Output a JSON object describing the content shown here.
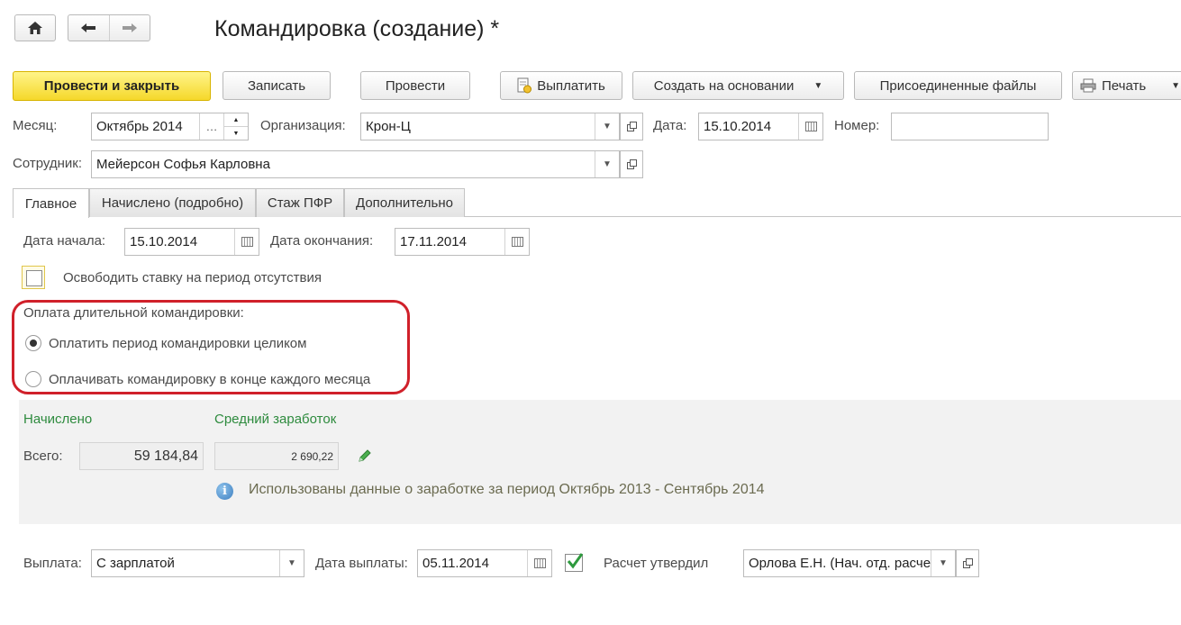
{
  "window": {
    "title": "Командировка (создание) *"
  },
  "toolbar": {
    "post_close": "Провести и закрыть",
    "save": "Записать",
    "post": "Провести",
    "pay": "Выплатить",
    "create_based": "Создать на основании",
    "attached_files": "Присоединенные файлы",
    "print": "Печать"
  },
  "header": {
    "month_label": "Месяц:",
    "month_value": "Октябрь 2014",
    "org_label": "Организация:",
    "org_value": "Крон-Ц",
    "date_label": "Дата:",
    "date_value": "15.10.2014",
    "number_label": "Номер:",
    "number_value": "",
    "employee_label": "Сотрудник:",
    "employee_value": "Мейерсон Софья Карловна"
  },
  "tabs": [
    {
      "label": "Главное",
      "active": true
    },
    {
      "label": "Начислено (подробно)",
      "active": false
    },
    {
      "label": "Стаж ПФР",
      "active": false
    },
    {
      "label": "Дополнительно",
      "active": false
    }
  ],
  "main": {
    "start_label": "Дата начала:",
    "start_value": "15.10.2014",
    "end_label": "Дата окончания:",
    "end_value": "17.11.2014",
    "free_rate_label": "Освободить ставку на период отсутствия",
    "free_rate_checked": false,
    "payment_group_label": "Оплата длительной командировки:",
    "payment_options": [
      {
        "label": "Оплатить период командировки целиком",
        "selected": true
      },
      {
        "label": "Оплачивать командировку в конце каждого месяца",
        "selected": false
      }
    ]
  },
  "accrued": {
    "title": "Начислено",
    "total_label": "Всего:",
    "total_value": "59 184,84",
    "avg_title": "Средний заработок",
    "avg_value": "2 690,22",
    "info_text": "Использованы данные о заработке за период Октябрь 2013 - Сентябрь 2014"
  },
  "footer": {
    "payment_label": "Выплата:",
    "payment_value": "С зарплатой",
    "pay_date_label": "Дата выплаты:",
    "pay_date_value": "05.11.2014",
    "approved_checked": true,
    "approved_label": "Расчет утвердил",
    "approver_value": "Орлова Е.Н. (Нач. отд. расче"
  },
  "colors": {
    "accent_yellow": "#f5d82a",
    "highlight_red": "#d0202a",
    "section_green": "#2e8b3e",
    "panel_gray": "#f2f2f2"
  }
}
